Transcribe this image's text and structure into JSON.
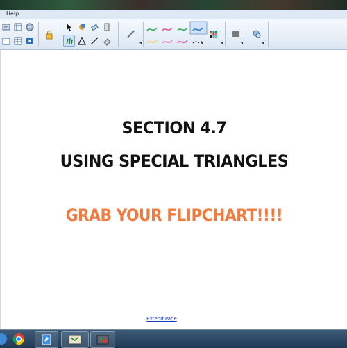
{
  "menubar": {
    "items": [
      "Help"
    ]
  },
  "toolbar": {
    "tools": [
      "undo-icon",
      "redo-icon",
      "delete-icon",
      "screen-shade-icon",
      "table-icon",
      "close-icon",
      "lock-icon",
      "select-icon",
      "pen-icon",
      "fill-icon",
      "eraser-icon",
      "shape-icon",
      "line-icon",
      "magic-pen-icon",
      "paint-bucket-icon",
      "pen-style-icon",
      "color-palette-icon",
      "properties-icon",
      "settings-icon"
    ],
    "colors": {
      "pen_green": "#2aa14b",
      "pen_pink": "#e0488a",
      "pen_blue": "#1c6fd0",
      "pen_red": "#d63a2f",
      "pen_black": "#222222"
    }
  },
  "slide": {
    "title_line1": "SECTION 4.7",
    "title_line2": "USING SPECIAL TRIANGLES",
    "subtitle": "GRAB YOUR FLIPCHART!!!!",
    "subtitle_color": "#f07b3f",
    "extend_link": "Extend Page"
  },
  "taskbar": {
    "items": [
      "start-orb-icon",
      "chrome-icon",
      "notebook-icon",
      "smart-board-icon",
      "smart-recorder-icon"
    ]
  }
}
